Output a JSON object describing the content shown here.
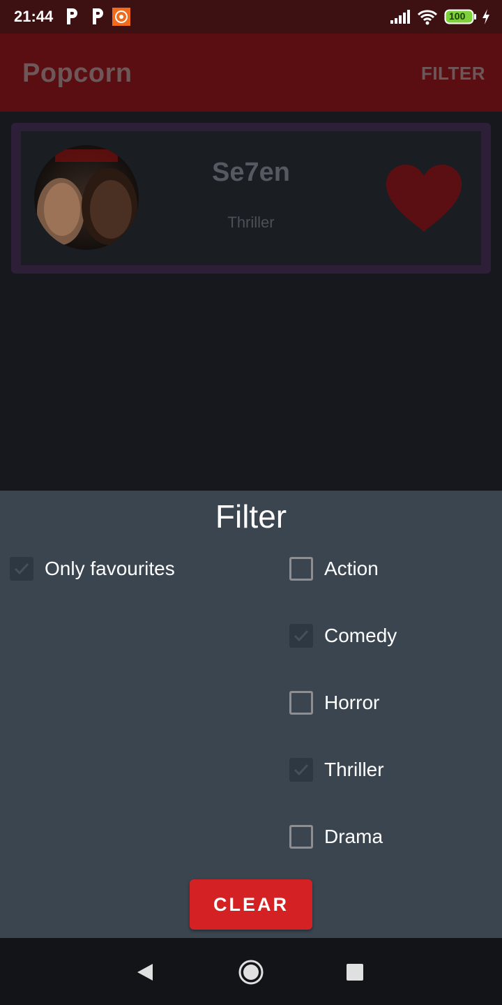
{
  "status_bar": {
    "time": "21:44",
    "battery": "100",
    "icons": [
      "p-notification-icon",
      "p-notification-icon",
      "screen-recorder-icon",
      "signal-icon",
      "wifi-icon",
      "battery-icon",
      "charging-icon"
    ]
  },
  "app_bar": {
    "title": "Popcorn",
    "action_label": "FILTER"
  },
  "movies": [
    {
      "title": "Se7en",
      "genre": "Thriller",
      "favourite": true
    }
  ],
  "filter_sheet": {
    "title": "Filter",
    "only_favourites": {
      "label": "Only favourites",
      "checked": true
    },
    "genres": [
      {
        "label": "Action",
        "checked": false
      },
      {
        "label": "Comedy",
        "checked": true
      },
      {
        "label": "Horror",
        "checked": false
      },
      {
        "label": "Thriller",
        "checked": true
      },
      {
        "label": "Drama",
        "checked": false
      }
    ],
    "clear_label": "CLEAR"
  },
  "colors": {
    "app_bar": "#5a0e11",
    "status_bar": "#3d1012",
    "sheet": "#3a4550",
    "clear_button": "#d42124",
    "heart": "#5c0f12",
    "card_border": "#2d1f37"
  },
  "nav_bar": {
    "icons": [
      "back-icon",
      "home-icon",
      "recents-icon"
    ]
  }
}
